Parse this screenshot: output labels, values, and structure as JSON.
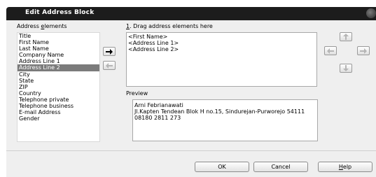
{
  "window": {
    "title": "Edit Address Block"
  },
  "address_elements": {
    "label_before": "Address ",
    "label_accel": "e",
    "label_after": "lements",
    "items": [
      "Title",
      "First Name",
      "Last Name",
      "Company Name",
      "Address Line 1",
      "Address Line 2",
      "City",
      "State",
      "ZIP",
      "Country",
      "Telephone private",
      "Telephone business",
      "E-mail Address",
      "Gender"
    ],
    "selected": "Address Line 2"
  },
  "drag_area": {
    "label_accel": "1",
    "label_rest": ". Drag address elements here",
    "lines": [
      "<First Name>",
      "<Address Line 1>",
      "<Address Line 2>"
    ]
  },
  "preview": {
    "label": "Preview",
    "lines": [
      "Arni Febrianawati",
      "Jl.Kapten Tendean Blok H no.15, Sindurejan-Purworejo 54111",
      "08180 2811 273"
    ]
  },
  "buttons": {
    "ok": "OK",
    "cancel": "Cancel",
    "help_accel": "H",
    "help_rest": "elp"
  },
  "icons": {
    "add": "arrow-right-icon",
    "remove": "arrow-left-icon",
    "move_up": "arrow-up-icon",
    "move_left": "arrow-left-icon",
    "move_right": "arrow-right-icon",
    "move_down": "arrow-down-icon"
  }
}
